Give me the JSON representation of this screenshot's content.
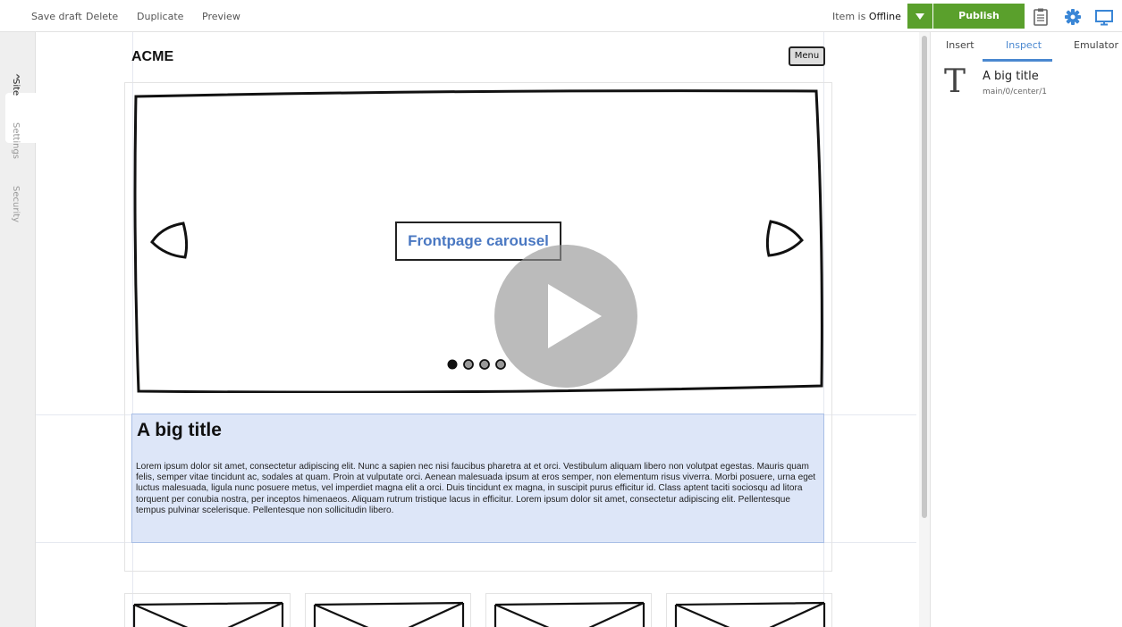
{
  "toolbar": {
    "save_draft": "Save draft",
    "delete": "Delete",
    "duplicate": "Duplicate",
    "preview": "Preview",
    "status_prefix": "Item is",
    "status_value": "Offline",
    "publish": "Publish",
    "icons": [
      "chevron-down-icon",
      "clipboard-icon",
      "gear-icon",
      "monitor-icon"
    ],
    "accent_color": "#5aa02c",
    "icon_color": "#3a86d6"
  },
  "left_tabs": [
    "Site",
    "Settings",
    "Security"
  ],
  "canvas": {
    "logo": "ACME",
    "menu_button": "Menu",
    "carousel_label": "Frontpage carousel",
    "carousel_dots": 4,
    "title": "A big title",
    "body": "Lorem ipsum dolor sit amet, consectetur adipiscing elit. Nunc a sapien nec nisi faucibus pharetra at et orci. Vestibulum aliquam libero non volutpat egestas. Mauris quam felis, semper vitae tincidunt ac, sodales at quam. Proin at vulputate orci. Aenean malesuada ipsum at eros semper, non elementum risus viverra. Morbi posuere, urna eget luctus malesuada, ligula nunc posuere metus, vel imperdiet magna elit a orci. Duis tincidunt ex magna, in suscipit purus efficitur id. Class aptent taciti sociosqu ad litora torquent per conubia nostra, per inceptos himenaeos. Aliquam rutrum tristique lacus in efficitur. Lorem ipsum dolor sit amet, consectetur adipiscing elit. Pellentesque tempus pulvinar scelerisque. Pellentesque non sollicitudin libero.",
    "selection_color": "#dde6f8"
  },
  "right_panel": {
    "tabs": [
      "Insert",
      "Inspect",
      "Emulator"
    ],
    "active_tab": "Inspect",
    "tree_item": {
      "name": "A big title",
      "path": "main/0/center/1"
    }
  }
}
